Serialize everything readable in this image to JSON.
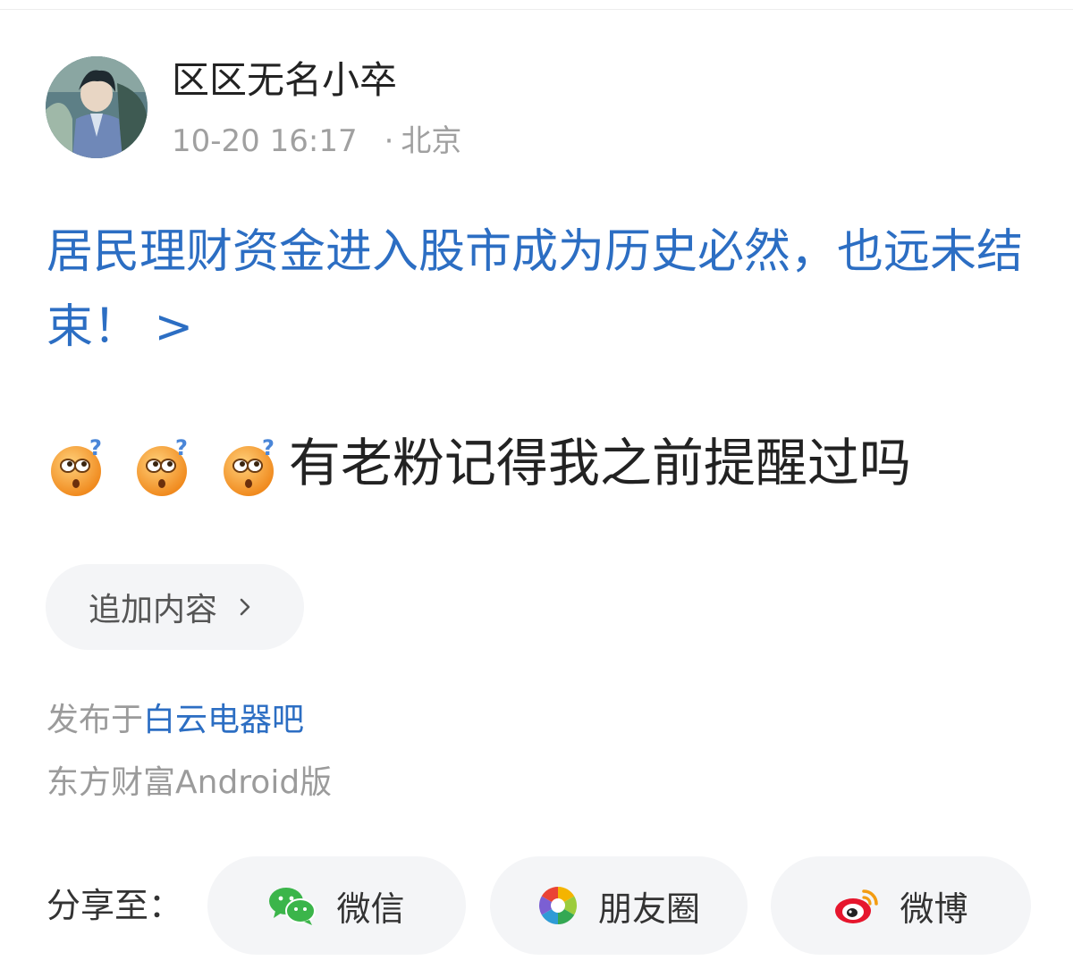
{
  "post": {
    "author": "区区无名小卒",
    "time": "10-20 16:17",
    "separator": "·",
    "location": "北京",
    "title_link": "居民理财资金进入股市成为历史必然，也远未结束！ >",
    "emoji_name": "confused-face-emoji",
    "content": "有老粉记得我之前提醒过吗",
    "append_label": "追加内容",
    "posted_prefix": "发布于",
    "bar_name": "白云电器吧",
    "client": "东方财富Android版"
  },
  "share": {
    "label": "分享至：",
    "wechat": "微信",
    "moments": "朋友圈",
    "weibo": "微博"
  },
  "colors": {
    "link": "#2c6ec3",
    "text": "#222222",
    "muted": "#9b9b9b",
    "pill_bg": "#f4f5f7"
  }
}
